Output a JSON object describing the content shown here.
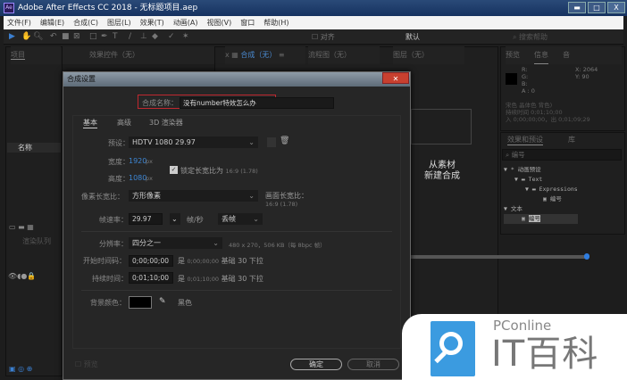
{
  "window": {
    "title": "Adobe After Effects CC 2018 - 无标题项目.aep",
    "app_icon": "Ae",
    "minimize": "▬",
    "maximize": "□",
    "close": "X"
  },
  "menu": [
    "文件(F)",
    "编辑(E)",
    "合成(C)",
    "图层(L)",
    "效果(T)",
    "动画(A)",
    "视图(V)",
    "窗口",
    "帮助(H)"
  ],
  "toolbar": {
    "snap_label": "对齐",
    "workspace": "默认",
    "search_help": "搜索帮助",
    "tools": [
      "selection-icon",
      "hand-icon",
      "zoom-icon",
      "rotate-icon",
      "camera-icon",
      "pan-icon",
      "rect-icon",
      "pen-icon",
      "text-icon",
      "brush-icon",
      "stamp-icon",
      "eraser-icon",
      "roto-icon",
      "puppet-icon"
    ]
  },
  "panels": {
    "project": {
      "tab": "项目",
      "effects_controls": "效果控件（无）",
      "column_name": "名称",
      "render_queue": "渲染队列"
    },
    "composition": {
      "tab": "合成（无）",
      "flowchart": "流程图（无）",
      "layer": "图层（无）",
      "new_from_footage": [
        "从素材",
        "新建合成"
      ]
    },
    "info": {
      "tabs": [
        "预览",
        "信息",
        "音"
      ],
      "r": "R:",
      "g": "G:",
      "b": "B:",
      "a": "A : 0",
      "x": "X: 2064",
      "y": "Y: 90",
      "note": [
        "宋色 晶体色 背色)",
        "持续时间 0;01;10;00",
        "入 0;00;00;00，出 0;01;09;29"
      ]
    },
    "effects": {
      "tabs": [
        "效果和预设",
        "库"
      ],
      "search": "编号",
      "tree": [
        {
          "label": "* 动画预设",
          "level": 0
        },
        {
          "label": "Text",
          "level": 1
        },
        {
          "label": "Expressions",
          "level": 2
        },
        {
          "label": "编号",
          "level": 3
        },
        {
          "label": "文本",
          "level": 0
        },
        {
          "label": "编号",
          "level": 1
        }
      ]
    }
  },
  "dialog": {
    "title": "合成设置",
    "close": "✕",
    "name_label": "合成名称：",
    "name_value": "没有number特效怎么办",
    "tabs": [
      "基本",
      "高级",
      "3D 渲染器"
    ],
    "preset_label": "预设：",
    "preset_value": "HDTV 1080 29.97",
    "width_label": "宽度：",
    "width_value": "1920",
    "height_label": "高度：",
    "height_value": "1080",
    "px": "px",
    "lock_label": "锁定长宽比为",
    "lock_ratio": "16:9 (1.78)",
    "lock_checked": true,
    "pixel_aspect_label": "像素长宽比：",
    "pixel_aspect_value": "方形像素",
    "frame_aspect_label": "画面长宽比：",
    "frame_aspect_value": "16:9 (1.78)",
    "fps_label": "帧速率：",
    "fps_value": "29.97",
    "fps_unit": "帧/秒",
    "drop_frame": "丢帧",
    "resolution_label": "分辨率：",
    "resolution_value": "四分之一",
    "resolution_info": "480 x 270，506 KB（每 8bpc 帧）",
    "start_label": "开始时间码：",
    "start_value": "0;00;00;00",
    "start_info": [
      "是",
      "0;00;00;00",
      "基础 30",
      "下拉"
    ],
    "duration_label": "持续时间：",
    "duration_value": "0;01;10;00",
    "duration_info": [
      "是",
      "0;01;10;00",
      "基础 30",
      "下拉"
    ],
    "bg_label": "背景颜色：",
    "bg_color": "#000000",
    "bg_name": "黑色",
    "preview": "预览",
    "ok": "确定",
    "cancel": "取消"
  },
  "watermark": {
    "brand": "PConline",
    "name": "IT百科",
    "color": "#3b9be0"
  }
}
